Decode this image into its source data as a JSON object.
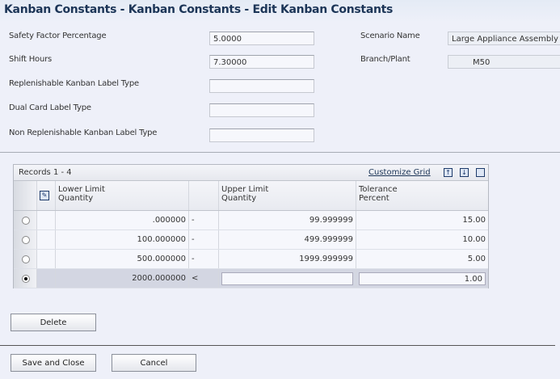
{
  "title": "Kanban Constants - Kanban Constants - Edit Kanban Constants",
  "form": {
    "safety_factor_label": "Safety Factor Percentage",
    "safety_factor_value": "5.0000",
    "shift_hours_label": "Shift Hours",
    "shift_hours_value": "7.30000",
    "replenishable_label": "Replenishable Kanban Label Type",
    "replenishable_value": "",
    "dual_card_label": "Dual Card Label Type",
    "dual_card_value": "",
    "non_replenishable_label": "Non Replenishable Kanban Label Type",
    "non_replenishable_value": "",
    "scenario_label": "Scenario Name",
    "scenario_value": "Large Appliance Assembly",
    "branch_label": "Branch/Plant",
    "branch_value": "M50"
  },
  "grid": {
    "records": "Records 1 - 4",
    "customize": "Customize Grid",
    "headers": {
      "lower1": "Lower Limit",
      "lower2": "Quantity",
      "upper1": "Upper Limit",
      "upper2": "Quantity",
      "tol1": "Tolerance",
      "tol2": "Percent"
    },
    "rows": [
      {
        "lower": ".000000",
        "op": "-",
        "upper": "99.999999",
        "tol": "15.00"
      },
      {
        "lower": "100.000000",
        "op": "-",
        "upper": "499.999999",
        "tol": "10.00"
      },
      {
        "lower": "500.000000",
        "op": "-",
        "upper": "1999.999999",
        "tol": "5.00"
      },
      {
        "lower": "2000.000000",
        "op": "<",
        "upper": "",
        "tol": "1.00"
      }
    ]
  },
  "buttons": {
    "delete": "Delete",
    "save_close": "Save and Close",
    "cancel": "Cancel"
  }
}
